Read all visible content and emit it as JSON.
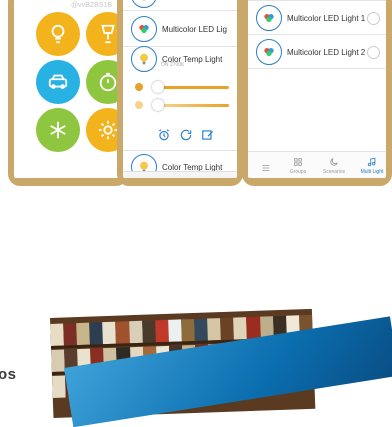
{
  "phone1": {
    "mini_label": "@vvBZBS1B"
  },
  "phone2": {
    "rows": [
      {
        "name": "Multicolor LED Lig",
        "sub": ""
      },
      {
        "name": "Color Temp Light",
        "sub": "ON 2700K"
      }
    ],
    "bottom_row": {
      "name": "Color Temp Light"
    }
  },
  "phone3": {
    "rows": [
      {
        "name": "Multicolor LED Light 1"
      },
      {
        "name": "Multicolor LED Light 2"
      }
    ],
    "tabs": [
      {
        "label": ""
      },
      {
        "label": "Groups"
      },
      {
        "label": "Scenarios"
      },
      {
        "label": "Multi Light"
      }
    ]
  },
  "side_text": "os",
  "colors": {
    "yellow": "#f2b31c",
    "cyan": "#27b2e3",
    "green": "#8ec63f",
    "gold_frame": "#c9a86a",
    "blue": "#2a7fc9",
    "orange": "#e9a12a"
  }
}
